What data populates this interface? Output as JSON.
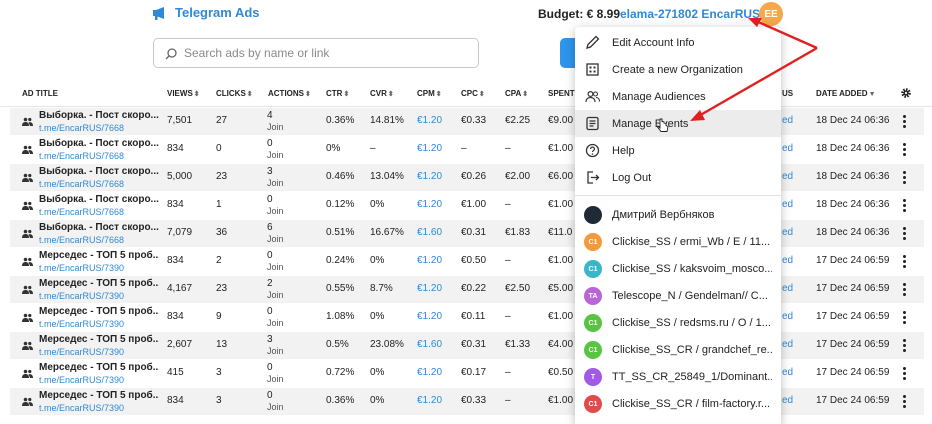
{
  "header": {
    "brand": "Telegram Ads",
    "budget": "Budget: € 8.99",
    "account": "elama-271802 EncarRUS",
    "avatar_initials": "EE"
  },
  "search": {
    "placeholder": "Search ads by name or link"
  },
  "table": {
    "columns": [
      "AD TITLE",
      "VIEWS",
      "CLICKS",
      "ACTIONS",
      "CTR",
      "CVR",
      "CPM",
      "CPC",
      "CPA",
      "SPENT",
      "US",
      "DATE ADDED"
    ],
    "rows": [
      {
        "title": "Выборка. - Пост скоро...",
        "link": "t.me/EncarRUS/7668",
        "views": "7,501",
        "clicks": "27",
        "actions": "4",
        "action_type": "Join",
        "ctr": "0.36%",
        "cvr": "14.81%",
        "cpm": "€1.20",
        "cpc": "€0.33",
        "cpa": "€2.25",
        "spent": "€9.00",
        "status": "ed",
        "date": "18 Dec 24 06:36"
      },
      {
        "title": "Выборка. - Пост скоро...",
        "link": "t.me/EncarRUS/7668",
        "views": "834",
        "clicks": "0",
        "actions": "0",
        "action_type": "Join",
        "ctr": "0%",
        "cvr": "–",
        "cpm": "€1.20",
        "cpc": "–",
        "cpa": "–",
        "spent": "€1.00",
        "status": "ed",
        "date": "18 Dec 24 06:36"
      },
      {
        "title": "Выборка. - Пост скоро...",
        "link": "t.me/EncarRUS/7668",
        "views": "5,000",
        "clicks": "23",
        "actions": "3",
        "action_type": "Join",
        "ctr": "0.46%",
        "cvr": "13.04%",
        "cpm": "€1.20",
        "cpc": "€0.26",
        "cpa": "€2.00",
        "spent": "€6.00",
        "status": "ed",
        "date": "18 Dec 24 06:36"
      },
      {
        "title": "Выборка. - Пост скоро...",
        "link": "t.me/EncarRUS/7668",
        "views": "834",
        "clicks": "1",
        "actions": "0",
        "action_type": "Join",
        "ctr": "0.12%",
        "cvr": "0%",
        "cpm": "€1.20",
        "cpc": "€1.00",
        "cpa": "–",
        "spent": "€1.00",
        "status": "ed",
        "date": "18 Dec 24 06:36"
      },
      {
        "title": "Выборка. - Пост скоро...",
        "link": "t.me/EncarRUS/7668",
        "views": "7,079",
        "clicks": "36",
        "actions": "6",
        "action_type": "Join",
        "ctr": "0.51%",
        "cvr": "16.67%",
        "cpm": "€1.60",
        "cpc": "€0.31",
        "cpa": "€1.83",
        "spent": "€11.0",
        "status": "ed",
        "date": "18 Dec 24 06:36"
      },
      {
        "title": "Мерседес - ТОП 5 проб...",
        "link": "t.me/EncarRUS/7390",
        "views": "834",
        "clicks": "2",
        "actions": "0",
        "action_type": "Join",
        "ctr": "0.24%",
        "cvr": "0%",
        "cpm": "€1.20",
        "cpc": "€0.50",
        "cpa": "–",
        "spent": "€1.00",
        "status": "ed",
        "date": "17 Dec 24 06:59"
      },
      {
        "title": "Мерседес - ТОП 5 проб...",
        "link": "t.me/EncarRUS/7390",
        "views": "4,167",
        "clicks": "23",
        "actions": "2",
        "action_type": "Join",
        "ctr": "0.55%",
        "cvr": "8.7%",
        "cpm": "€1.20",
        "cpc": "€0.22",
        "cpa": "€2.50",
        "spent": "€5.00",
        "status": "ed",
        "date": "17 Dec 24 06:59"
      },
      {
        "title": "Мерседес - ТОП 5 проб...",
        "link": "t.me/EncarRUS/7390",
        "views": "834",
        "clicks": "9",
        "actions": "0",
        "action_type": "Join",
        "ctr": "1.08%",
        "cvr": "0%",
        "cpm": "€1.20",
        "cpc": "€0.11",
        "cpa": "–",
        "spent": "€1.00",
        "status": "ed",
        "date": "17 Dec 24 06:59"
      },
      {
        "title": "Мерседес - ТОП 5 проб...",
        "link": "t.me/EncarRUS/7390",
        "views": "2,607",
        "clicks": "13",
        "actions": "3",
        "action_type": "Join",
        "ctr": "0.5%",
        "cvr": "23.08%",
        "cpm": "€1.60",
        "cpc": "€0.31",
        "cpa": "€1.33",
        "spent": "€4.00",
        "status": "ed",
        "date": "17 Dec 24 06:59"
      },
      {
        "title": "Мерседес - ТОП 5 проб...",
        "link": "t.me/EncarRUS/7390",
        "views": "415",
        "clicks": "3",
        "actions": "0",
        "action_type": "Join",
        "ctr": "0.72%",
        "cvr": "0%",
        "cpm": "€1.20",
        "cpc": "€0.17",
        "cpa": "–",
        "spent": "€0.50",
        "status": "ed",
        "date": "17 Dec 24 06:59"
      },
      {
        "title": "Мерседес - ТОП 5 проб...",
        "link": "t.me/EncarRUS/7390",
        "views": "834",
        "clicks": "3",
        "actions": "0",
        "action_type": "Join",
        "ctr": "0.36%",
        "cvr": "0%",
        "cpm": "€1.20",
        "cpc": "€0.33",
        "cpa": "–",
        "spent": "€1.00",
        "status": "ed",
        "date": "17 Dec 24 06:59"
      }
    ]
  },
  "menu": {
    "items": [
      {
        "label": "Edit Account Info",
        "icon": "pencil-icon"
      },
      {
        "label": "Create a new Organization",
        "icon": "building-icon"
      },
      {
        "label": "Manage Audiences",
        "icon": "users-icon"
      },
      {
        "label": "Manage Events",
        "icon": "list-icon"
      },
      {
        "label": "Help",
        "icon": "help-icon"
      },
      {
        "label": "Log Out",
        "icon": "logout-icon"
      }
    ],
    "organizations": [
      {
        "label": "Дмитрий Вербняков",
        "badge": "",
        "color": "#1f2a36"
      },
      {
        "label": "Clickise_SS / ermi_Wb / E / 11...",
        "badge": "C1",
        "color": "#f29b3c"
      },
      {
        "label": "Clickise_SS / kaksvoim_mosco...",
        "badge": "C1",
        "color": "#38b7c9"
      },
      {
        "label": "Telescope_N / Gendelman// C...",
        "badge": "TA",
        "color": "#b866d6"
      },
      {
        "label": "Clickise_SS / redsms.ru / O / 1...",
        "badge": "C1",
        "color": "#59c442"
      },
      {
        "label": "Clickise_SS_CR / grandchef_re...",
        "badge": "C1",
        "color": "#59c442"
      },
      {
        "label": "TT_SS_CR_25849_1/Dominant...",
        "badge": "T",
        "color": "#a259e6"
      },
      {
        "label": "Clickise_SS_CR / film-factory.r...",
        "badge": "C1",
        "color": "#e04b4b"
      }
    ]
  },
  "colors": {
    "accent": "#2e89d8",
    "avatar": "#f4a84a",
    "arrow": "#e02020"
  }
}
